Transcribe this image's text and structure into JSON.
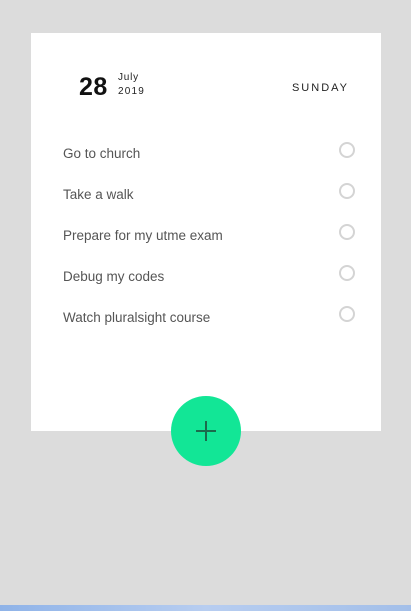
{
  "header": {
    "day": "28",
    "month": "July",
    "year": "2019",
    "weekday": "SUNDAY"
  },
  "tasks": [
    {
      "label": "Go to church",
      "done": false
    },
    {
      "label": "Take a walk",
      "done": false
    },
    {
      "label": "Prepare for my utme exam",
      "done": false
    },
    {
      "label": "Debug my codes",
      "done": false
    },
    {
      "label": "Watch pluralsight course",
      "done": false
    }
  ],
  "add_button": {
    "icon": "plus-icon"
  },
  "colors": {
    "background": "#dcdcdc",
    "card": "#ffffff",
    "accent": "#12e696"
  }
}
